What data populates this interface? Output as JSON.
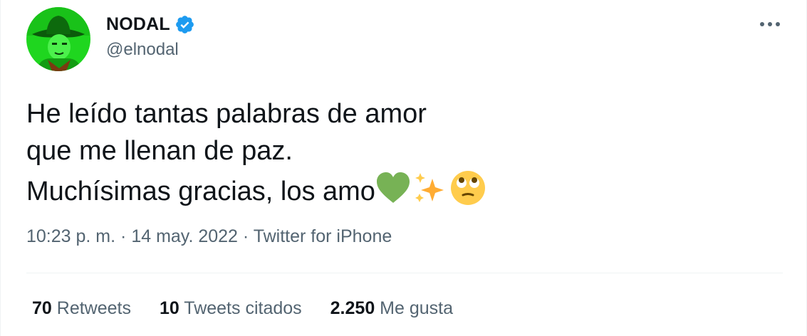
{
  "user": {
    "display_name": "NODAL",
    "handle": "@elnodal",
    "verified": true,
    "avatar_icon": "profile-avatar-green-cowboy"
  },
  "tweet": {
    "lines": [
      "He leído tantas palabras de amor",
      "que me llenan de paz.",
      "Muchísimas gracias, los amo"
    ],
    "emojis": [
      "green-heart",
      "sparkles",
      "face-with-rolling-eyes"
    ]
  },
  "meta": {
    "time": "10:23 p. m.",
    "separator": "·",
    "date": "14 may. 2022",
    "source": "Twitter for iPhone"
  },
  "stats": {
    "retweets_count": "70",
    "retweets_label": "Retweets",
    "quotes_count": "10",
    "quotes_label": "Tweets citados",
    "likes_count": "2.250",
    "likes_label": "Me gusta"
  },
  "colors": {
    "text_primary": "#0f1419",
    "text_secondary": "#536471",
    "verified_blue": "#1d9bf0",
    "divider": "#eff3f4"
  }
}
